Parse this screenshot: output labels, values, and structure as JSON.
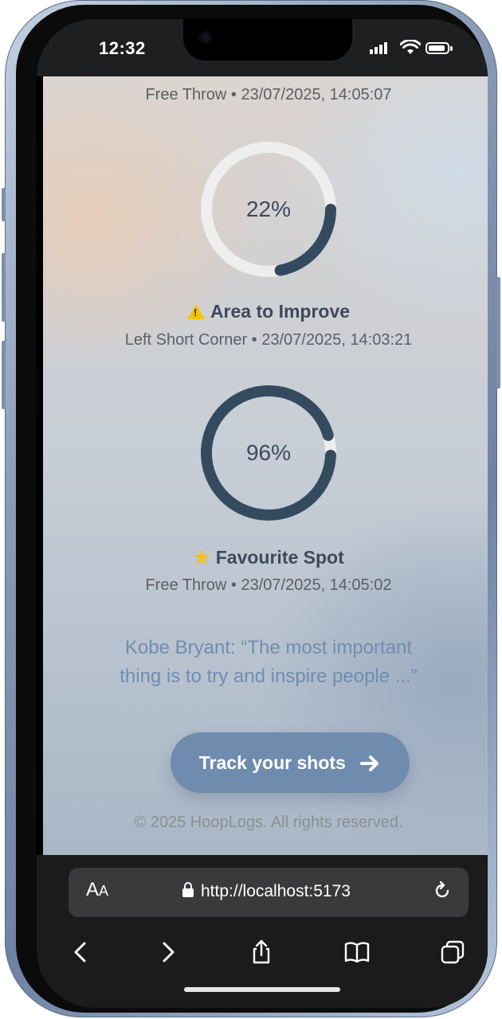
{
  "status_bar": {
    "time": "12:32"
  },
  "entries": [
    {
      "label": "",
      "meta": "Free Throw • 23/07/2025, 14:05:07"
    },
    {
      "percent_text": "22%",
      "percent": 22,
      "label": "Area to Improve",
      "icon": "warning-icon",
      "meta": "Left Short Corner • 23/07/2025, 14:03:21"
    },
    {
      "percent_text": "96%",
      "percent": 96,
      "label": "Favourite Spot",
      "icon": "star-icon",
      "meta": "Free Throw • 23/07/2025, 14:05:02"
    }
  ],
  "quote": {
    "line1": "Kobe Bryant: “The most important",
    "line2": "thing is to try and inspire people ...”"
  },
  "cta": {
    "label": "Track your shots",
    "icon": "arrow-right-icon"
  },
  "footer": {
    "text": "© 2025 HoopLogs. All rights reserved."
  },
  "browser": {
    "aa_label": "A",
    "aa_small": "A",
    "url": "http://localhost:5173"
  },
  "colors": {
    "ring_fill": "#344a5f",
    "ring_track": "#eeeeee",
    "cta_bg": "#6f8cae",
    "quote_text": "#6f8db0"
  }
}
